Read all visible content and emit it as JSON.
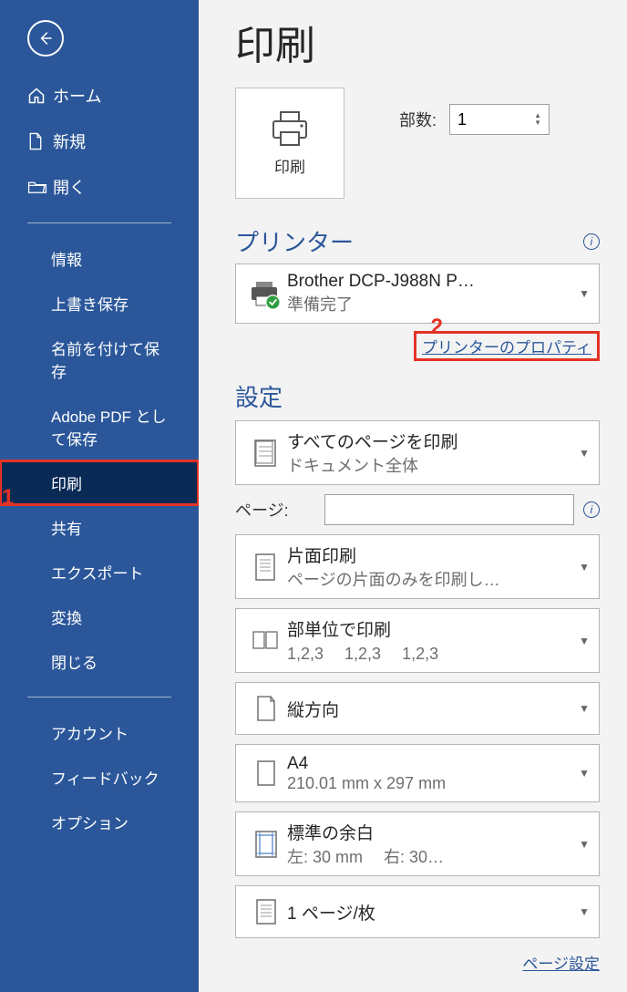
{
  "sidebar": {
    "items": [
      {
        "label": "ホーム"
      },
      {
        "label": "新規"
      },
      {
        "label": "開く"
      },
      {
        "label": "情報"
      },
      {
        "label": "上書き保存"
      },
      {
        "label": "名前を付けて保存"
      },
      {
        "label": "Adobe PDF として保存"
      },
      {
        "label": "印刷"
      },
      {
        "label": "共有"
      },
      {
        "label": "エクスポート"
      },
      {
        "label": "変換"
      },
      {
        "label": "閉じる"
      },
      {
        "label": "アカウント"
      },
      {
        "label": "フィードバック"
      },
      {
        "label": "オプション"
      }
    ]
  },
  "page_title": "印刷",
  "print_button_label": "印刷",
  "copies": {
    "label": "部数:",
    "value": "1"
  },
  "sections": {
    "printer": "プリンター",
    "settings": "設定"
  },
  "printer": {
    "name": "Brother DCP-J988N P…",
    "status": "準備完了",
    "properties_link": "プリンターのプロパティ"
  },
  "settings": {
    "pages_scope": {
      "title": "すべてのページを印刷",
      "sub": "ドキュメント全体"
    },
    "pages_row_label": "ページ:",
    "duplex": {
      "title": "片面印刷",
      "sub": "ページの片面のみを印刷し…"
    },
    "collate": {
      "title": "部単位で印刷",
      "sub": "1,2,3　 1,2,3　 1,2,3"
    },
    "orientation": {
      "title": "縦方向"
    },
    "paper": {
      "title": "A4",
      "sub": "210.01 mm x 297 mm"
    },
    "margins": {
      "title": "標準の余白",
      "sub": "左:   30 mm　 右:   30…"
    },
    "sheets": {
      "title": "1 ページ/枚"
    },
    "page_setup_link": "ページ設定"
  },
  "annotations": {
    "one": "1",
    "two": "2"
  }
}
